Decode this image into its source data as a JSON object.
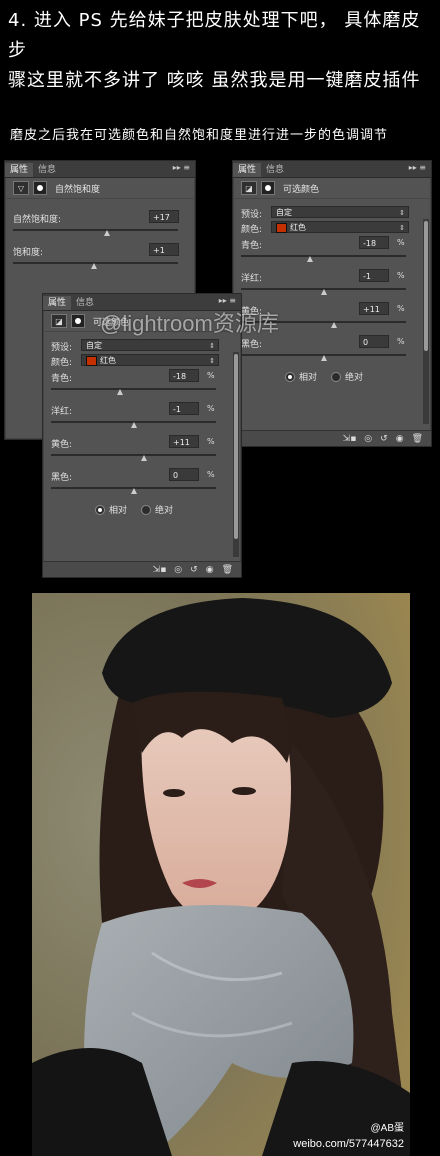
{
  "heading": {
    "line1": "4. 进入 PS 先给妹子把皮肤处理下吧， 具体磨皮步",
    "line2": "骤这里就不多讲了 咳咳 虽然我是用一键磨皮插件"
  },
  "subheading": "磨皮之后我在可选颜色和自然饱和度里进行进一步的色调调节",
  "panel_vibrance": {
    "tab_properties": "属性",
    "tab_info": "信息",
    "title": "自然饱和度",
    "rows": [
      {
        "label": "自然饱和度:",
        "value": "+17",
        "position": 0.6
      },
      {
        "label": "饱和度:",
        "value": "+1",
        "position": 0.52
      }
    ]
  },
  "panel_selective_right": {
    "tab_properties": "属性",
    "tab_info": "信息",
    "title": "可选颜色",
    "preset_label": "预设:",
    "preset_value": "自定",
    "color_label": "颜色:",
    "color_value": "红色",
    "rows": [
      {
        "label": "青色:",
        "value": "-18",
        "position": 0.42
      },
      {
        "label": "洋红:",
        "value": "-1",
        "position": 0.5
      },
      {
        "label": "黄色:",
        "value": "+11",
        "position": 0.56
      },
      {
        "label": "黑色:",
        "value": "0",
        "position": 0.5
      }
    ],
    "radio_relative": "相对",
    "radio_absolute": "绝对"
  },
  "panel_selective_front": {
    "tab_properties": "属性",
    "tab_info": "信息",
    "title": "可选颜色",
    "preset_label": "预设:",
    "preset_value": "自定",
    "color_label": "颜色:",
    "color_value": "红色",
    "rows": [
      {
        "label": "青色:",
        "value": "-18",
        "position": 0.42
      },
      {
        "label": "洋红:",
        "value": "-1",
        "position": 0.5
      },
      {
        "label": "黄色:",
        "value": "+11",
        "position": 0.56
      },
      {
        "label": "黑色:",
        "value": "0",
        "position": 0.5
      }
    ],
    "radio_relative": "相对",
    "radio_absolute": "绝对"
  },
  "watermark": "@lightroom资源库",
  "photo_caption_user": "@AB蛋",
  "photo_caption_url": "weibo.com/577447632"
}
